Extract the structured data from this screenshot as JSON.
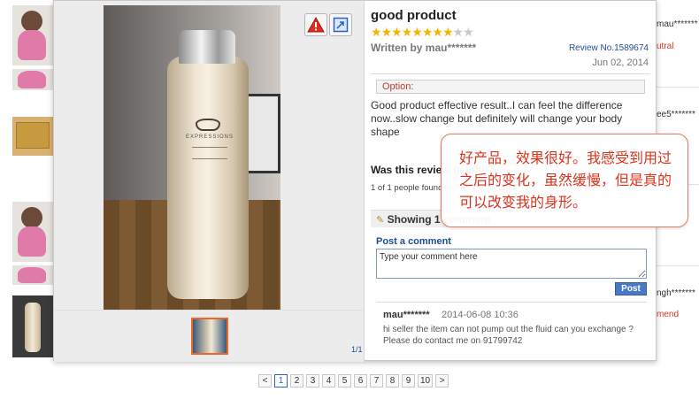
{
  "background": {
    "right_rows": [
      {
        "text": "mau*******",
        "tone": "normal"
      },
      {
        "text": "utral",
        "tone": "red"
      },
      {
        "text": "ee5*******",
        "tone": "normal"
      },
      {
        "text": "ngh*******",
        "tone": "normal"
      },
      {
        "text": "mend",
        "tone": "red"
      }
    ]
  },
  "viewer": {
    "counter": "1/1",
    "photo_brand": "EXPRESSIONS"
  },
  "review": {
    "title": "good product",
    "rating": 8,
    "rating_max": 10,
    "written_by": "Written by mau*******",
    "review_no": "Review No.1589674",
    "date": "Jun 02, 2014",
    "option_label": "Option:",
    "text": "Good product effective result..I can feel the difference now..slow change but definitely will change your body shape",
    "helpful_question": "Was this review helpful?",
    "helpful_count": "1 of 1 people found this review helpful.",
    "comments_header": "Showing 1 comment",
    "post_comment_label": "Post a comment",
    "comment_placeholder": "Type your comment here",
    "post_button": "Post",
    "comments": [
      {
        "user": "mau*******",
        "date": "2014-06-08 10:36",
        "text": "hi seller the item can not pump out the fluid can you exchange ? Please do contact me on 91799742"
      }
    ]
  },
  "callout": {
    "text": "好产品，效果很好。我感受到用过之后的变化，虽然缓慢，但是真的可以改变我的身形。"
  },
  "pagination": {
    "prev": "<",
    "next": ">",
    "pages": [
      "1",
      "2",
      "3",
      "4",
      "5",
      "6",
      "7",
      "8",
      "9",
      "10"
    ],
    "current": "1"
  },
  "colors": {
    "star_on": "#f5b400",
    "link_blue": "#1f4d98",
    "callout_red": "#d9331c",
    "thumb_border": "#f26522"
  },
  "icons": {
    "report": "warning-icon",
    "expand": "expand-icon",
    "comments": "pencil-icon"
  }
}
